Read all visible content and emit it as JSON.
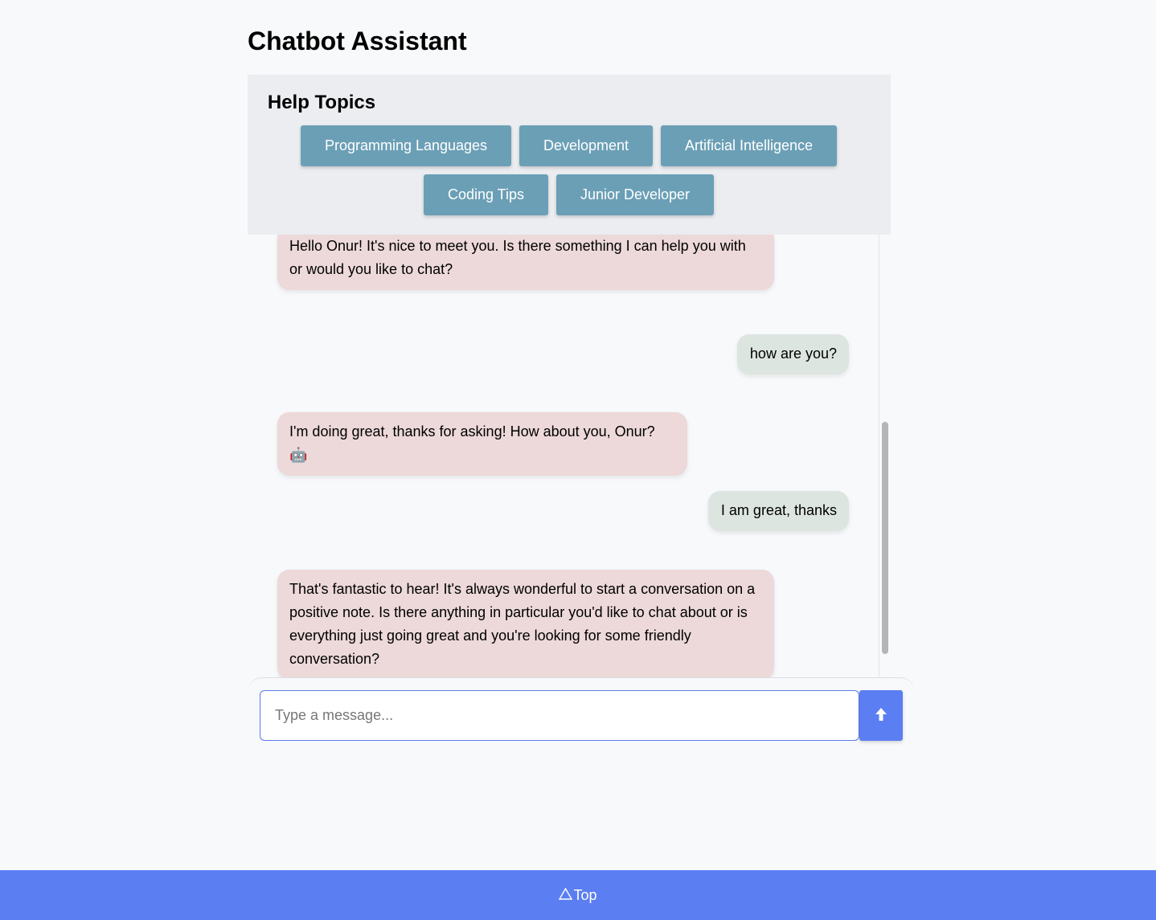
{
  "app": {
    "title": "Chatbot Assistant"
  },
  "help_topics": {
    "title": "Help Topics",
    "buttons": [
      {
        "label": "Programming Languages"
      },
      {
        "label": "Development"
      },
      {
        "label": "Artificial Intelligence"
      },
      {
        "label": "Coding Tips"
      },
      {
        "label": "Junior Developer"
      }
    ]
  },
  "messages": [
    {
      "sender": "bot",
      "text": "Hello Onur! It's nice to meet you. Is there something I can help you with or would you like to chat?"
    },
    {
      "sender": "user",
      "text": "how are you?"
    },
    {
      "sender": "bot",
      "text": "I'm doing great, thanks for asking! How about you, Onur? 🤖"
    },
    {
      "sender": "user",
      "text": "I am great, thanks"
    },
    {
      "sender": "bot",
      "text": "That's fantastic to hear! It's always wonderful to start a conversation on a positive note. Is there anything in particular you'd like to chat about or is everything just going great and you're looking for some friendly conversation?"
    }
  ],
  "composer": {
    "placeholder": "Type a message...",
    "value": "",
    "send_icon": "arrow-up-icon"
  },
  "footer": {
    "top_label": "Top",
    "top_icon": "triangle-up-icon"
  },
  "colors": {
    "accent": "#5b7ef2",
    "topic_button": "#6b9fb6",
    "bot_bubble": "#edd9da",
    "user_bubble": "#dde5e0",
    "help_panel_bg": "#ebedf0",
    "page_bg": "#f7f9fb"
  }
}
